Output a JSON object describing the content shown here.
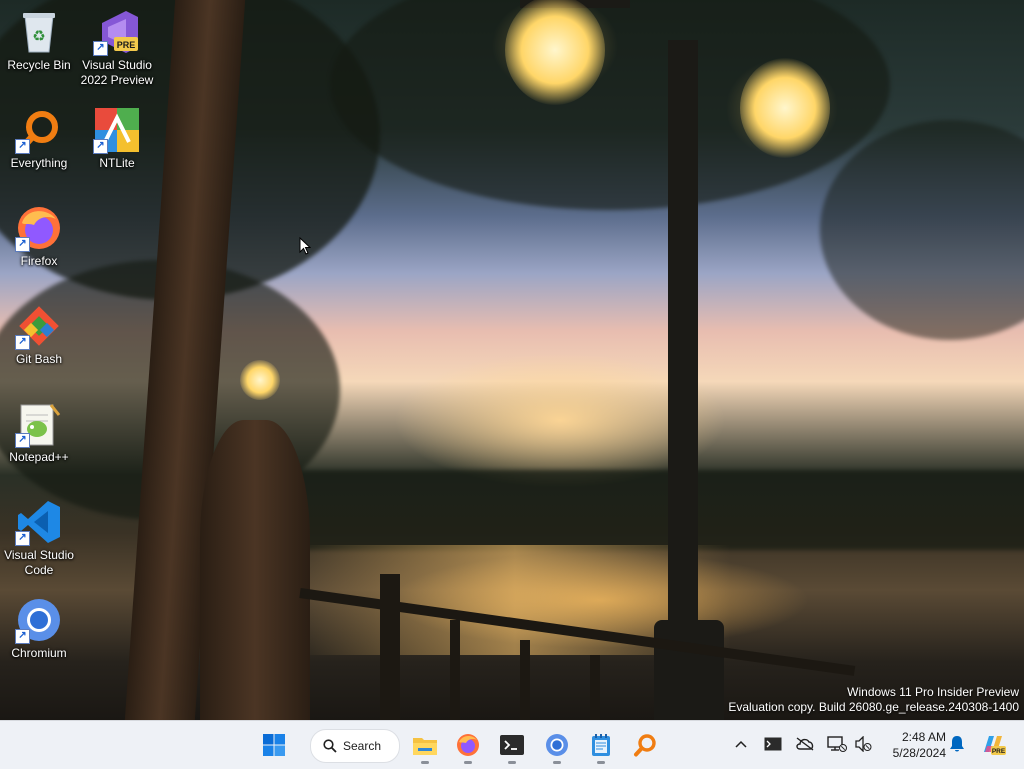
{
  "desktop": {
    "icons": [
      {
        "label": "Recycle Bin",
        "icon": "recycle-bin-icon",
        "shortcut": false
      },
      {
        "label": "Visual Studio 2022 Preview",
        "icon": "visual-studio-icon",
        "shortcut": true,
        "badge": "PRE"
      },
      {
        "label": "Everything",
        "icon": "everything-search-icon",
        "shortcut": true
      },
      {
        "label": "NTLite",
        "icon": "ntlite-icon",
        "shortcut": true
      },
      {
        "label": "Firefox",
        "icon": "firefox-icon",
        "shortcut": true
      },
      {
        "label": "Git Bash",
        "icon": "git-bash-icon",
        "shortcut": true
      },
      {
        "label": "Notepad++",
        "icon": "notepad-plus-plus-icon",
        "shortcut": true
      },
      {
        "label": "Visual Studio Code",
        "icon": "vscode-icon",
        "shortcut": true
      },
      {
        "label": "Chromium",
        "icon": "chromium-icon",
        "shortcut": true
      }
    ],
    "watermark": {
      "line1": "Windows 11 Pro Insider Preview",
      "line2": "Evaluation copy. Build 26080.ge_release.240308-1400"
    }
  },
  "taskbar": {
    "search_label": "Search",
    "apps": [
      {
        "name": "File Explorer",
        "icon": "file-explorer-icon"
      },
      {
        "name": "Firefox",
        "icon": "firefox-icon"
      },
      {
        "name": "Terminal",
        "icon": "terminal-icon"
      },
      {
        "name": "Chromium",
        "icon": "chromium-icon"
      },
      {
        "name": "Notepad",
        "icon": "notepad-icon"
      },
      {
        "name": "Everything",
        "icon": "everything-search-icon"
      }
    ],
    "clock": {
      "time": "2:48 AM",
      "date": "5/28/2024"
    },
    "copilot_badge": "PRE"
  },
  "colors": {
    "taskbar_bg": "#eef1f6",
    "accent": "#0067c0"
  }
}
